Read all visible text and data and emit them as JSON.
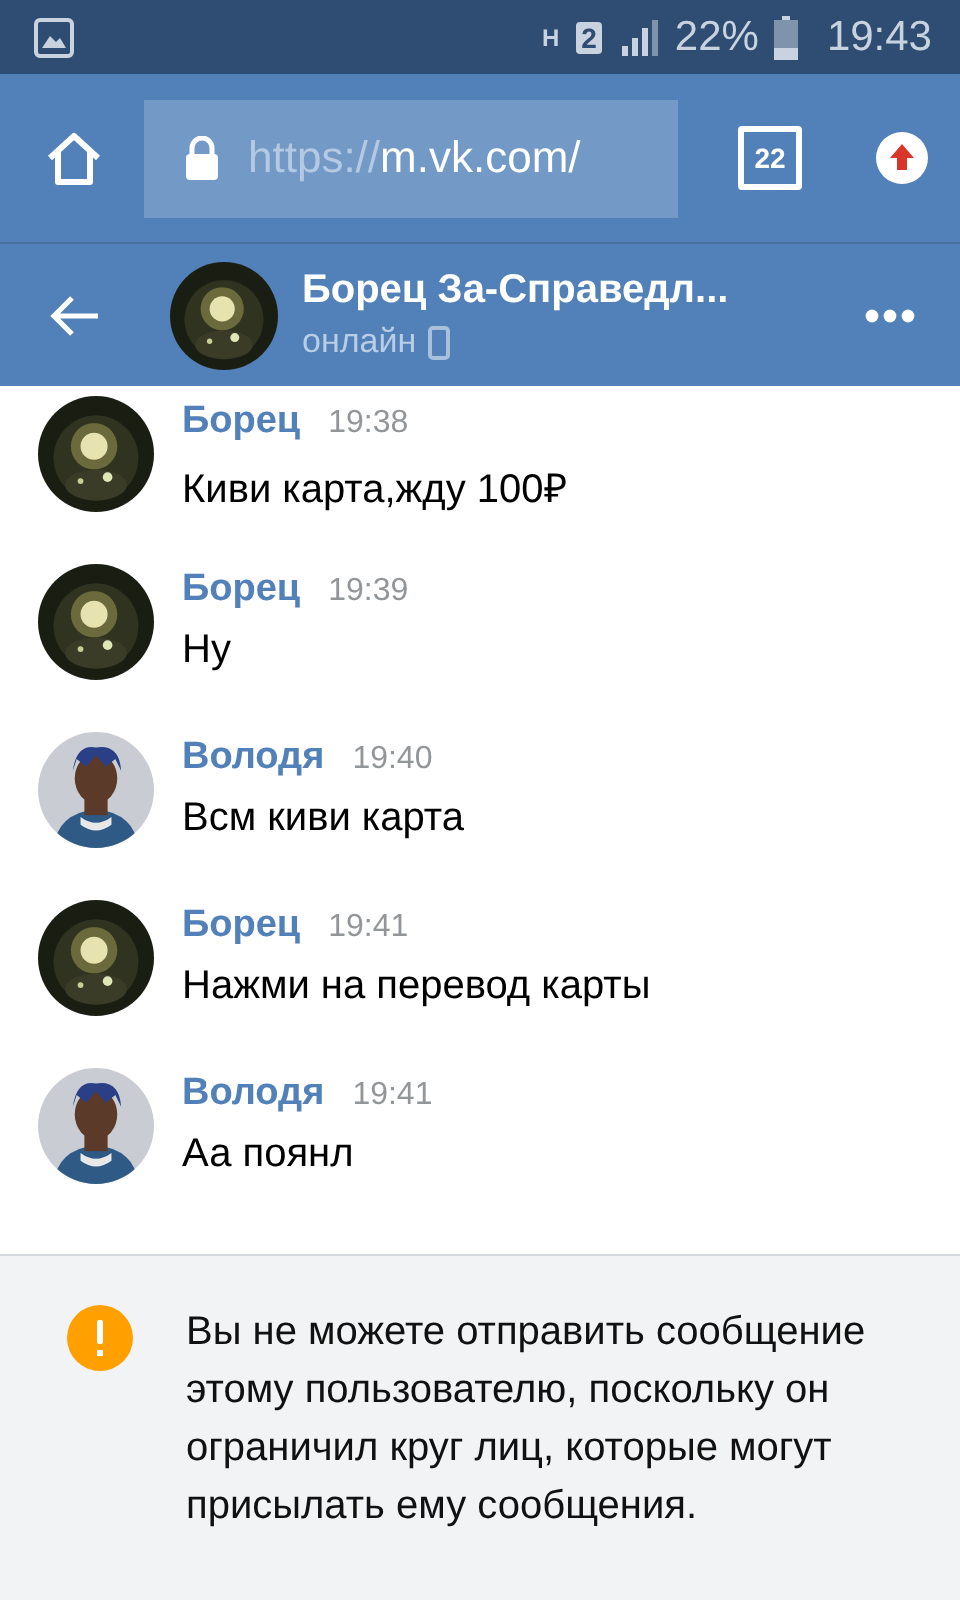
{
  "status_bar": {
    "network": "H",
    "sim": "2",
    "battery": "22%",
    "time": "19:43"
  },
  "browser": {
    "url_scheme": "https://",
    "url_rest": "m.vk.com/",
    "tab_count": "22"
  },
  "chat_header": {
    "title": "Борец За-Справедл...",
    "status": "онлайн"
  },
  "messages": [
    {
      "author": "Борец",
      "time": "19:38",
      "text": "Киви карта,жду 100₽"
    },
    {
      "author": "Борец",
      "time": "19:39",
      "text": "Ну"
    },
    {
      "author": "Володя",
      "time": "19:40",
      "text": "Всм киви карта"
    },
    {
      "author": "Борец",
      "time": "19:41",
      "text": "Нажми на перевод карты"
    },
    {
      "author": "Володя",
      "time": "19:41",
      "text": "Аа поянл"
    }
  ],
  "notice": {
    "text": "Вы не можете отправить сообщение этому пользователю, поскольку он ограничил круг лиц, которые могут присылать ему сообщения."
  }
}
